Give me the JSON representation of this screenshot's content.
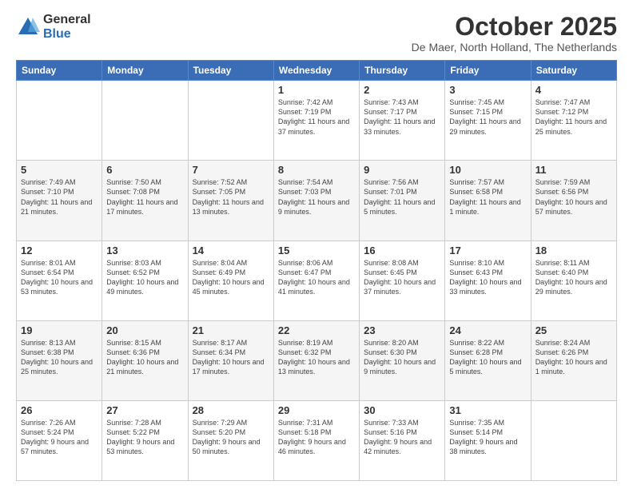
{
  "logo": {
    "general": "General",
    "blue": "Blue"
  },
  "title": {
    "month": "October 2025",
    "location": "De Maer, North Holland, The Netherlands"
  },
  "days_of_week": [
    "Sunday",
    "Monday",
    "Tuesday",
    "Wednesday",
    "Thursday",
    "Friday",
    "Saturday"
  ],
  "weeks": [
    [
      {
        "day": "",
        "info": ""
      },
      {
        "day": "",
        "info": ""
      },
      {
        "day": "",
        "info": ""
      },
      {
        "day": "1",
        "info": "Sunrise: 7:42 AM\nSunset: 7:19 PM\nDaylight: 11 hours and 37 minutes."
      },
      {
        "day": "2",
        "info": "Sunrise: 7:43 AM\nSunset: 7:17 PM\nDaylight: 11 hours and 33 minutes."
      },
      {
        "day": "3",
        "info": "Sunrise: 7:45 AM\nSunset: 7:15 PM\nDaylight: 11 hours and 29 minutes."
      },
      {
        "day": "4",
        "info": "Sunrise: 7:47 AM\nSunset: 7:12 PM\nDaylight: 11 hours and 25 minutes."
      }
    ],
    [
      {
        "day": "5",
        "info": "Sunrise: 7:49 AM\nSunset: 7:10 PM\nDaylight: 11 hours and 21 minutes."
      },
      {
        "day": "6",
        "info": "Sunrise: 7:50 AM\nSunset: 7:08 PM\nDaylight: 11 hours and 17 minutes."
      },
      {
        "day": "7",
        "info": "Sunrise: 7:52 AM\nSunset: 7:05 PM\nDaylight: 11 hours and 13 minutes."
      },
      {
        "day": "8",
        "info": "Sunrise: 7:54 AM\nSunset: 7:03 PM\nDaylight: 11 hours and 9 minutes."
      },
      {
        "day": "9",
        "info": "Sunrise: 7:56 AM\nSunset: 7:01 PM\nDaylight: 11 hours and 5 minutes."
      },
      {
        "day": "10",
        "info": "Sunrise: 7:57 AM\nSunset: 6:58 PM\nDaylight: 11 hours and 1 minute."
      },
      {
        "day": "11",
        "info": "Sunrise: 7:59 AM\nSunset: 6:56 PM\nDaylight: 10 hours and 57 minutes."
      }
    ],
    [
      {
        "day": "12",
        "info": "Sunrise: 8:01 AM\nSunset: 6:54 PM\nDaylight: 10 hours and 53 minutes."
      },
      {
        "day": "13",
        "info": "Sunrise: 8:03 AM\nSunset: 6:52 PM\nDaylight: 10 hours and 49 minutes."
      },
      {
        "day": "14",
        "info": "Sunrise: 8:04 AM\nSunset: 6:49 PM\nDaylight: 10 hours and 45 minutes."
      },
      {
        "day": "15",
        "info": "Sunrise: 8:06 AM\nSunset: 6:47 PM\nDaylight: 10 hours and 41 minutes."
      },
      {
        "day": "16",
        "info": "Sunrise: 8:08 AM\nSunset: 6:45 PM\nDaylight: 10 hours and 37 minutes."
      },
      {
        "day": "17",
        "info": "Sunrise: 8:10 AM\nSunset: 6:43 PM\nDaylight: 10 hours and 33 minutes."
      },
      {
        "day": "18",
        "info": "Sunrise: 8:11 AM\nSunset: 6:40 PM\nDaylight: 10 hours and 29 minutes."
      }
    ],
    [
      {
        "day": "19",
        "info": "Sunrise: 8:13 AM\nSunset: 6:38 PM\nDaylight: 10 hours and 25 minutes."
      },
      {
        "day": "20",
        "info": "Sunrise: 8:15 AM\nSunset: 6:36 PM\nDaylight: 10 hours and 21 minutes."
      },
      {
        "day": "21",
        "info": "Sunrise: 8:17 AM\nSunset: 6:34 PM\nDaylight: 10 hours and 17 minutes."
      },
      {
        "day": "22",
        "info": "Sunrise: 8:19 AM\nSunset: 6:32 PM\nDaylight: 10 hours and 13 minutes."
      },
      {
        "day": "23",
        "info": "Sunrise: 8:20 AM\nSunset: 6:30 PM\nDaylight: 10 hours and 9 minutes."
      },
      {
        "day": "24",
        "info": "Sunrise: 8:22 AM\nSunset: 6:28 PM\nDaylight: 10 hours and 5 minutes."
      },
      {
        "day": "25",
        "info": "Sunrise: 8:24 AM\nSunset: 6:26 PM\nDaylight: 10 hours and 1 minute."
      }
    ],
    [
      {
        "day": "26",
        "info": "Sunrise: 7:26 AM\nSunset: 5:24 PM\nDaylight: 9 hours and 57 minutes."
      },
      {
        "day": "27",
        "info": "Sunrise: 7:28 AM\nSunset: 5:22 PM\nDaylight: 9 hours and 53 minutes."
      },
      {
        "day": "28",
        "info": "Sunrise: 7:29 AM\nSunset: 5:20 PM\nDaylight: 9 hours and 50 minutes."
      },
      {
        "day": "29",
        "info": "Sunrise: 7:31 AM\nSunset: 5:18 PM\nDaylight: 9 hours and 46 minutes."
      },
      {
        "day": "30",
        "info": "Sunrise: 7:33 AM\nSunset: 5:16 PM\nDaylight: 9 hours and 42 minutes."
      },
      {
        "day": "31",
        "info": "Sunrise: 7:35 AM\nSunset: 5:14 PM\nDaylight: 9 hours and 38 minutes."
      },
      {
        "day": "",
        "info": ""
      }
    ]
  ]
}
